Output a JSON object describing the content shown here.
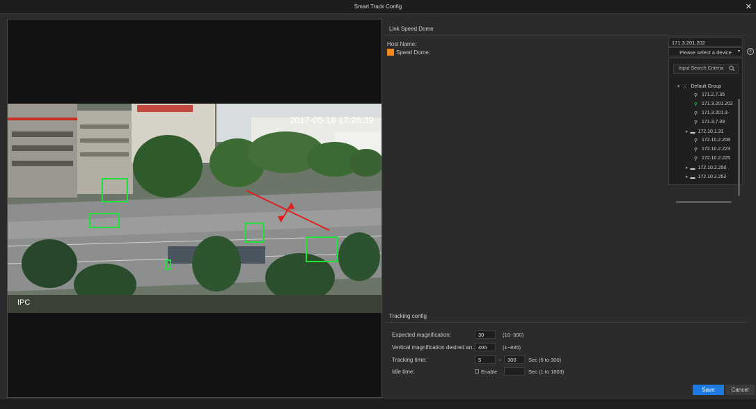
{
  "window": {
    "title": "Smart Track Config"
  },
  "video": {
    "overlay_timestamp": "2017-05-18 17:28:39",
    "channel_label": "IPC"
  },
  "link": {
    "section_title": "Link Speed Dome",
    "host_label": "Host Name:",
    "host_value": "171.3.201.202",
    "dome_label": "Speed Dome:",
    "device_select": "Please select a device",
    "search_placeholder": "Input Search Criteria",
    "tree": {
      "group": "Default Group",
      "items": [
        {
          "label": "171.2.7.35",
          "type": "dome"
        },
        {
          "label": "171.3.201.202",
          "type": "dome-selected"
        },
        {
          "label": "171.3.201.3",
          "type": "dome"
        },
        {
          "label": "171.3.7.39",
          "type": "dome"
        },
        {
          "label": "172.10.1.31",
          "type": "nvr"
        },
        {
          "label": "172.10.2.208",
          "type": "dome"
        },
        {
          "label": "172.10.2.223",
          "type": "dome"
        },
        {
          "label": "172.10.2.225",
          "type": "dome"
        },
        {
          "label": "172.10.2.250",
          "type": "nvr"
        },
        {
          "label": "172.10.2.252",
          "type": "nvr"
        }
      ]
    }
  },
  "tracking": {
    "section_title": "Tracking config",
    "expected_label": "Expected magnification:",
    "expected_value": "30",
    "expected_hint": "(10~300)",
    "vertical_label": "Vertical magnification desired an...",
    "vertical_value": "400",
    "vertical_hint": "(1~895)",
    "time_label": "Tracking time:",
    "time_min": "5",
    "time_sep": "-",
    "time_max": "300",
    "time_hint": "Sec (5 to 300)",
    "idle_label": "Idle time:",
    "idle_enable": "Enable",
    "idle_hint": "Sec (1 to 1803)"
  },
  "buttons": {
    "save": "Save",
    "cancel": "Cancel"
  },
  "colors": {
    "accent": "#1e7ae0",
    "swatch": "#f08a1c",
    "box": "#22e03a",
    "arrow": "#e01e1e"
  }
}
